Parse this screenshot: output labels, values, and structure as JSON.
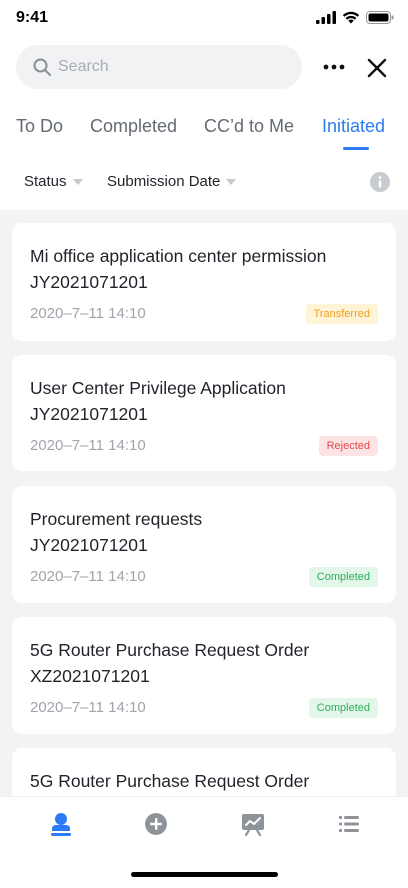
{
  "status_bar": {
    "time": "9:41"
  },
  "search": {
    "placeholder": "Search"
  },
  "tabs": [
    {
      "label": "To Do",
      "active": false
    },
    {
      "label": "Completed",
      "active": false
    },
    {
      "label": "CC’d to Me",
      "active": false
    },
    {
      "label": "Initiated",
      "active": true
    }
  ],
  "filters": {
    "status_label": "Status",
    "date_label": "Submission Date"
  },
  "colors": {
    "accent": "#2b7bf6",
    "transferred": "#f0a020",
    "rejected": "#e5484d",
    "completed": "#2fae5a"
  },
  "requests": [
    {
      "title": "Mi office application center permission",
      "code": "JY2021071201",
      "date": "2020–7–11 14:10",
      "status": "Transferred"
    },
    {
      "title": "User Center Privilege Application",
      "code": "JY2021071201",
      "date": "2020–7–11 14:10",
      "status": "Rejected"
    },
    {
      "title": "Procurement requests",
      "code": "JY2021071201",
      "date": "2020–7–11 14:10",
      "status": "Completed"
    },
    {
      "title": "5G Router Purchase Request Order",
      "code": "XZ2021071201",
      "date": "2020–7–11 14:10",
      "status": "Completed"
    },
    {
      "title": "5G Router Purchase Request Order"
    }
  ],
  "bottom_nav": [
    {
      "icon": "user-stamp-icon",
      "active": true
    },
    {
      "icon": "add-circle-icon",
      "active": false
    },
    {
      "icon": "chart-board-icon",
      "active": false
    },
    {
      "icon": "list-icon",
      "active": false
    }
  ]
}
